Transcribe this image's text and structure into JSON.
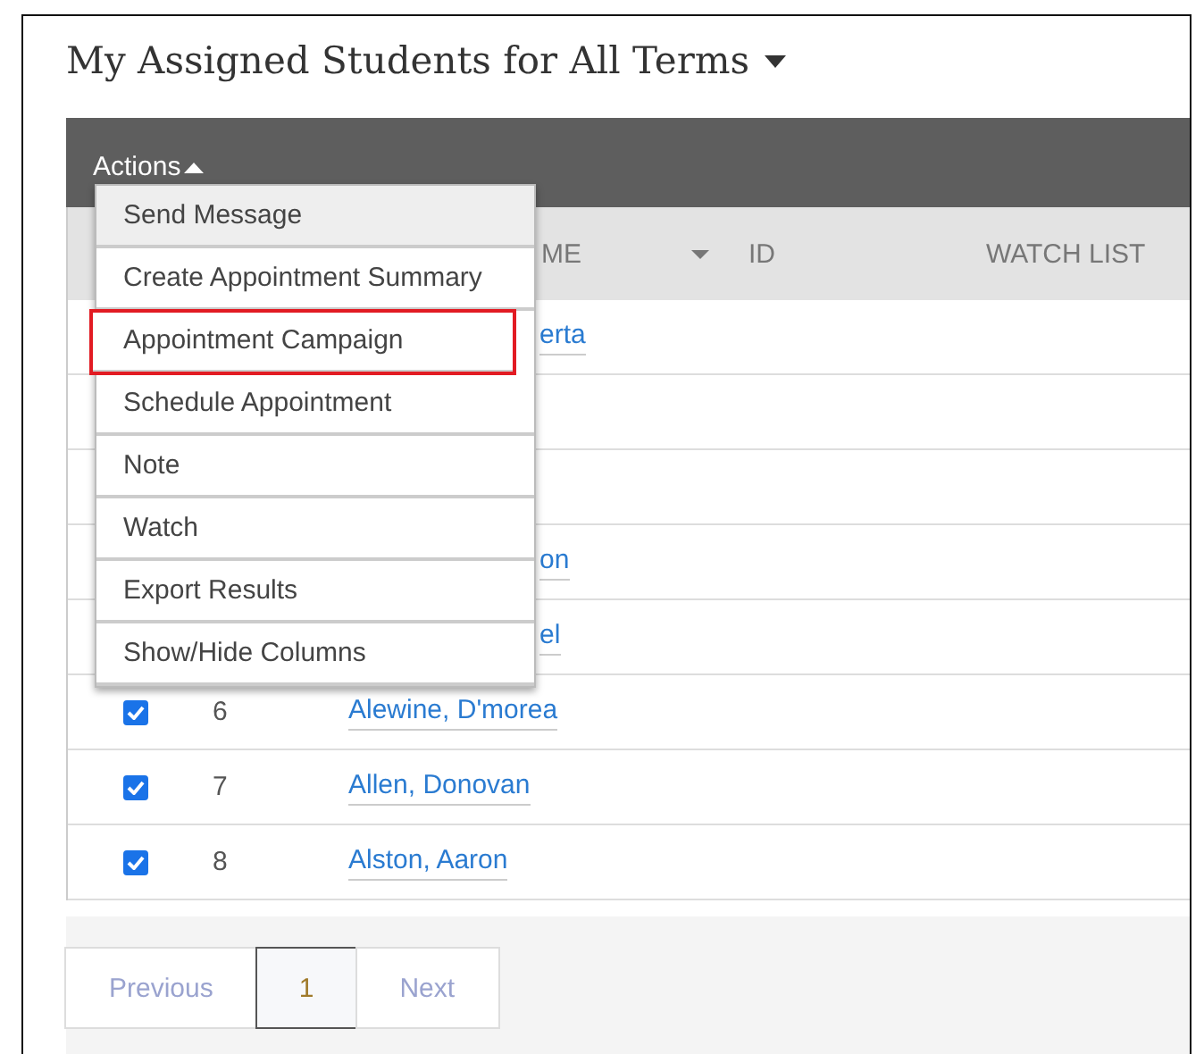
{
  "title": "My Assigned Students for All Terms",
  "actions": {
    "label": "Actions",
    "expanded": true
  },
  "columns": [
    {
      "kind": "name",
      "label": "ME"
    },
    {
      "kind": "id",
      "label": "ID"
    },
    {
      "kind": "watch",
      "label": "WATCH LIST"
    }
  ],
  "rows": [
    {
      "kind": "covered",
      "name": "erta"
    },
    {
      "kind": "covered"
    },
    {
      "kind": "covered"
    },
    {
      "kind": "covered",
      "name": "on"
    },
    {
      "kind": "covered",
      "name": "el"
    },
    {
      "kind": "student",
      "number": "6",
      "name": "Alewine, D'morea",
      "checked": true
    },
    {
      "kind": "student",
      "number": "7",
      "name": "Allen, Donovan",
      "checked": true
    },
    {
      "kind": "student",
      "number": "8",
      "name": "Alston, Aaron",
      "checked": true
    }
  ],
  "menu": [
    {
      "label": "Send Message",
      "highlighted": true,
      "annotated": false
    },
    {
      "label": "Create Appointment Summary",
      "highlighted": false,
      "annotated": false
    },
    {
      "label": "Appointment Campaign",
      "highlighted": false,
      "annotated": true
    },
    {
      "label": "Schedule Appointment",
      "highlighted": false,
      "annotated": false
    },
    {
      "label": "Note",
      "highlighted": false,
      "annotated": false
    },
    {
      "label": "Watch",
      "highlighted": false,
      "annotated": false
    },
    {
      "label": "Export Results",
      "highlighted": false,
      "annotated": false
    },
    {
      "label": "Show/Hide Columns",
      "highlighted": false,
      "annotated": false
    }
  ],
  "pagination": [
    {
      "label": "Previous",
      "selected": false
    },
    {
      "label": "1",
      "selected": true
    },
    {
      "label": "Next",
      "selected": false
    }
  ]
}
